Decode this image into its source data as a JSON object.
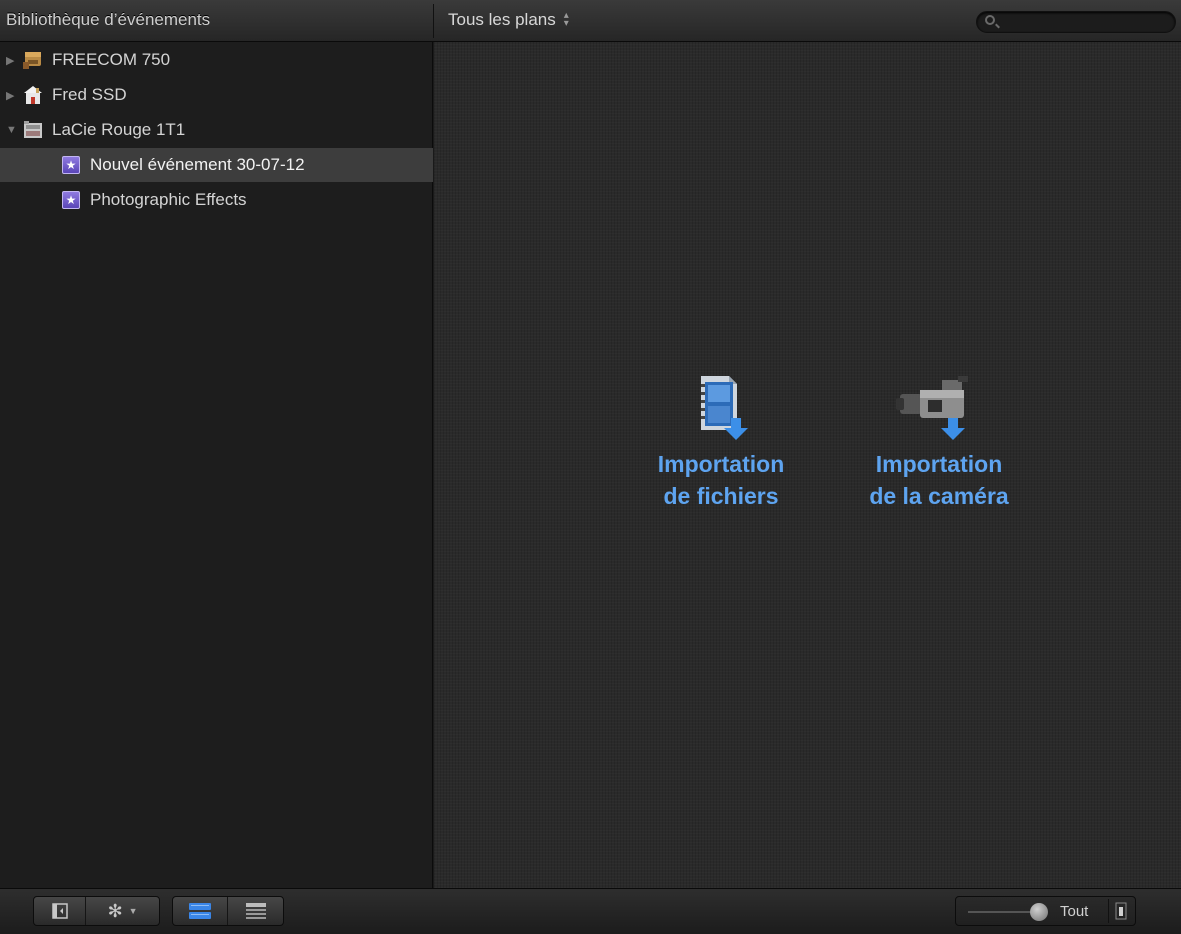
{
  "header": {
    "library_title": "Bibliothèque d’événements",
    "filter_label": "Tous les plans",
    "search_placeholder": ""
  },
  "sidebar": {
    "items": [
      {
        "label": "FREECOM 750",
        "icon": "drive-icon",
        "expanded": false
      },
      {
        "label": "Fred SSD",
        "icon": "home-drive-icon",
        "expanded": false
      },
      {
        "label": "LaCie Rouge 1T1",
        "icon": "drive-icon",
        "expanded": true
      },
      {
        "label": "Nouvel événement 30-07-12",
        "icon": "event-star-icon",
        "selected": true
      },
      {
        "label": "Photographic Effects",
        "icon": "event-star-icon",
        "selected": false
      }
    ]
  },
  "main": {
    "import_files": {
      "line1": "Importation",
      "line2": "de fichiers",
      "icon": "film-import-icon"
    },
    "import_camera": {
      "line1": "Importation",
      "line2": "de la caméra",
      "icon": "camera-import-icon"
    }
  },
  "bottom": {
    "zoom_label": "Tout",
    "zoom_level": 0.95
  },
  "colors": {
    "accent_blue": "#5ea4f0",
    "selection": "#3d3d3d",
    "event_purple": "#7b66d4"
  }
}
